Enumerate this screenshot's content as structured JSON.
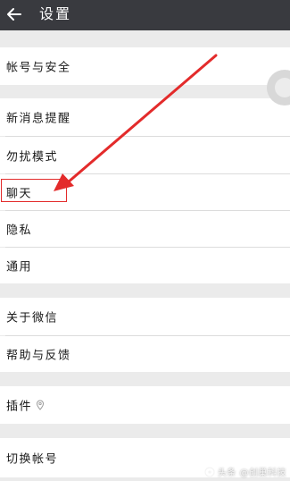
{
  "header": {
    "title": "设置",
    "back_icon": "back-arrow-icon"
  },
  "menu": {
    "group1": [
      "帐号与安全"
    ],
    "group2": [
      "新消息提醒",
      "勿扰模式",
      "聊天",
      "隐私",
      "通用"
    ],
    "group3": [
      "关于微信",
      "帮助与反馈"
    ],
    "group4": [
      "插件"
    ],
    "group5": [
      "切换帐号"
    ]
  },
  "plugin_icon": "location-pin-icon",
  "annotation": {
    "highlighted_item": "聊天",
    "color": "#e32b2b"
  },
  "watermark": {
    "text": "头条 @创巢科技"
  },
  "colors": {
    "titlebar": "#393a3f",
    "background": "#ebebeb",
    "row": "#ffffff"
  }
}
